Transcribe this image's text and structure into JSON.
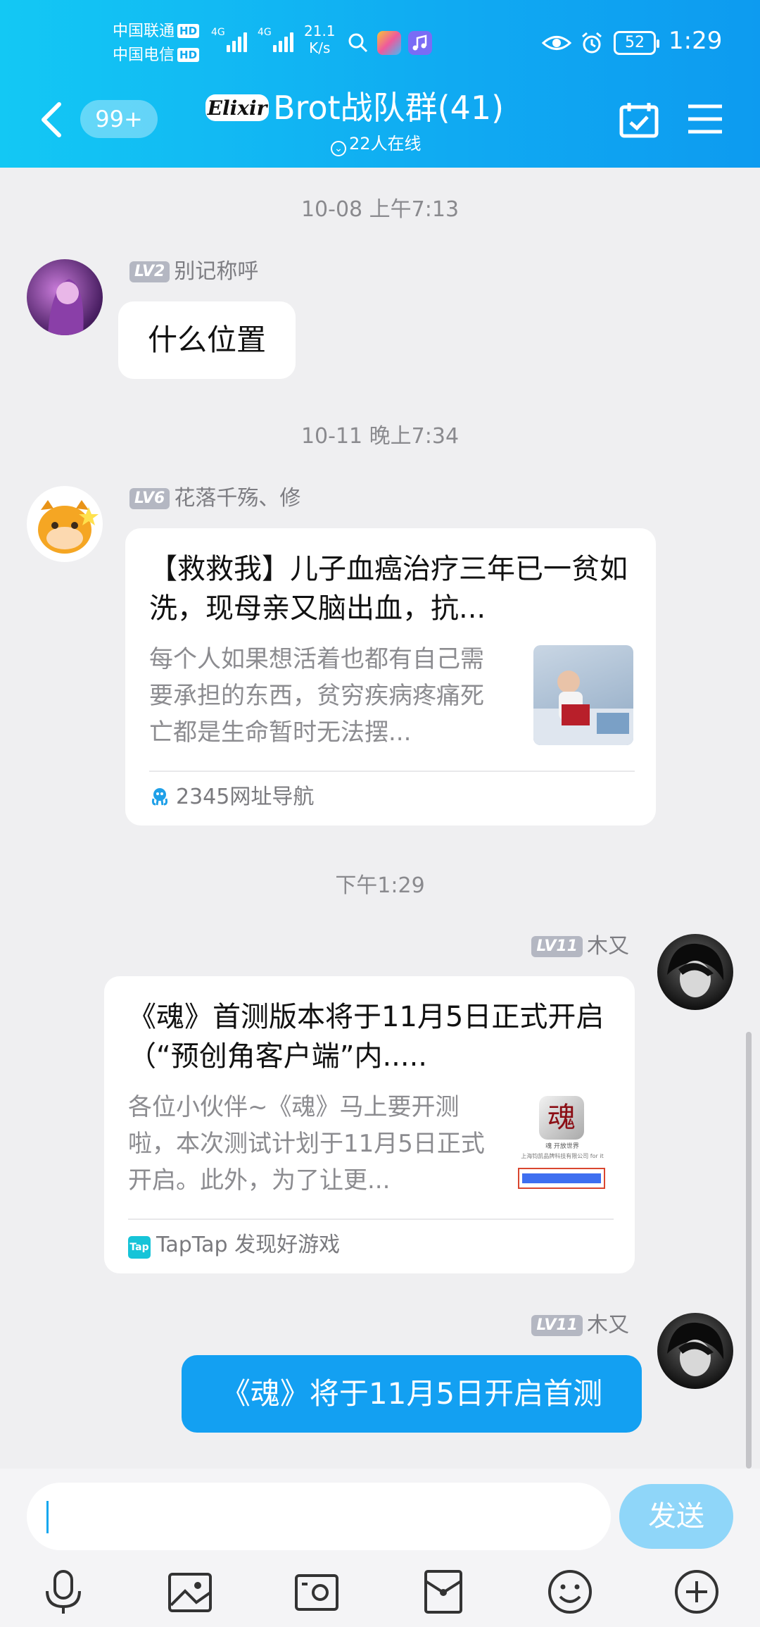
{
  "status_bar": {
    "carrier1": "中国联通",
    "carrier2": "中国电信",
    "hd": "HD",
    "net": "4G",
    "speed_value": "21.1",
    "speed_unit": "K/s",
    "battery": "52",
    "time": "1:29"
  },
  "header": {
    "unread_badge": "99+",
    "logo_text": "Elixir",
    "group_name": "Brot战队群(41)",
    "online": "22人在线"
  },
  "messages": [
    {
      "timestamp": "10-08 上午7:13",
      "level": "LV2",
      "name": "别记称呼",
      "text": "什么位置"
    },
    {
      "timestamp": "10-11 晚上7:34",
      "level": "LV6",
      "name": "花落千殇、修",
      "card": {
        "title": "【救救我】儿子血癌治疗三年已一贫如洗，现母亲又脑出血，抗...",
        "desc": "每个人如果想活着也都有自己需要承担的东西，贫穷疾病疼痛死亡都是生命暂时无法摆...",
        "source": "2345网址导航"
      }
    },
    {
      "timestamp": "下午1:29",
      "level": "LV11",
      "name": "木又",
      "card": {
        "title": "《魂》首测版本将于11月5日正式开启（“预创角客户端”内.....",
        "desc": "各位小伙伴~《魂》马上要开测啦，本次测试计划于11月5日正式开启。此外，为了让更...",
        "source": "TapTap 发现好游戏",
        "source_icon": "Tap",
        "thumb_caption1": "魂 开放世界",
        "thumb_caption2": "上海钧凯品牌科技有限公司 for it"
      }
    },
    {
      "level": "LV11",
      "name": "木又",
      "text": "《魂》将于11月5日开启首测"
    }
  ],
  "input": {
    "placeholder": "",
    "send_label": "发送"
  },
  "toolbar": [
    "mic-icon",
    "image-icon",
    "camera-icon",
    "red-packet-icon",
    "emoji-icon",
    "plus-icon"
  ],
  "colors": {
    "header": "#10aaf2",
    "own_bubble": "#13a0f2",
    "send_button": "#8fd6f9"
  }
}
